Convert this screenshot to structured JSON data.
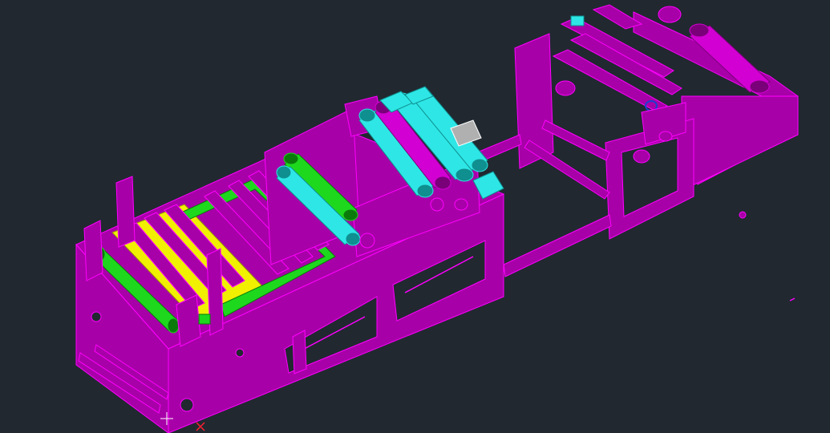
{
  "viewport": {
    "background": "#212830"
  },
  "colors": {
    "frame": "#a800a8",
    "frame_edge": "#ff00ff",
    "frame_dark": "#6e006e",
    "roller_green": "#1ed81e",
    "roller_green_dark": "#0a7a0a",
    "roller_cyan": "#2ee6e6",
    "roller_cyan_dark": "#0f8f8f",
    "roller_magenta": "#d200d2",
    "roller_magenta_dark": "#7a007a",
    "film_yellow": "#f0f000",
    "film_yellow_dark": "#9a9a00",
    "guard_gray": "#b0b0b0",
    "accent_blue": "#1b3fd0",
    "ucs_marker": "#ff2030"
  },
  "icons": {
    "ucs": "ucs-icon",
    "cursor": "crosshair-icon"
  }
}
